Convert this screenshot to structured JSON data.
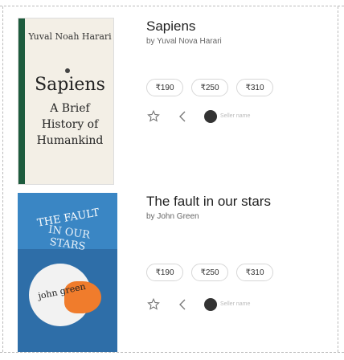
{
  "books": [
    {
      "title": "Sapiens",
      "byline": "by Yuval Nova Harari",
      "cover": {
        "author": "Yuval Noah Harari",
        "title": "Sapiens",
        "subtitle": "A Brief History of Humankind",
        "spine_color": "#1d5b3d"
      },
      "prices": [
        "₹190",
        "₹250",
        "₹310"
      ],
      "actions": {
        "like_icon": "star-outline-icon",
        "share_icon": "share-icon",
        "reader_icon": "avatar-icon",
        "reader_text": "Seller name"
      }
    },
    {
      "title": "The fault in our stars",
      "byline": "by John Green",
      "cover": {
        "title_line1": "THE FAULT",
        "title_line2": "IN OUR STARS",
        "author": "john green",
        "accent": "#f07c2c"
      },
      "prices": [
        "₹190",
        "₹250",
        "₹310"
      ],
      "actions": {
        "like_icon": "star-outline-icon",
        "share_icon": "share-icon",
        "reader_icon": "avatar-icon",
        "reader_text": "Seller name"
      }
    }
  ]
}
